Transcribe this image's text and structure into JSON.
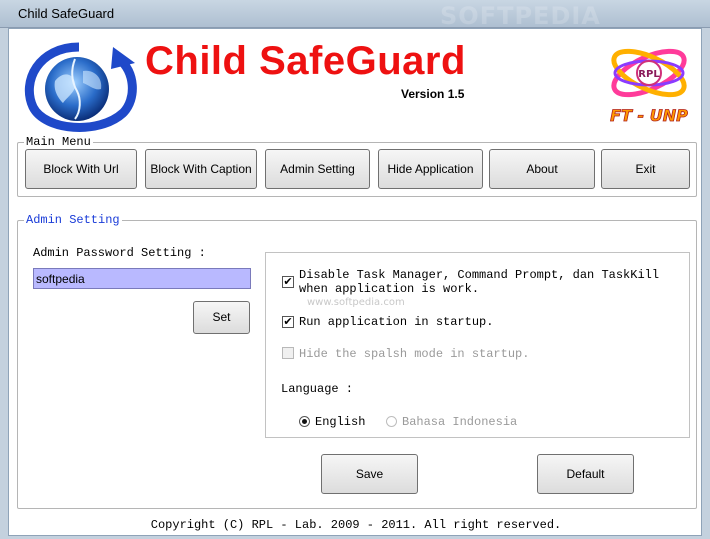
{
  "window": {
    "title": "Child SafeGuard",
    "watermark": "SOFTPEDIA"
  },
  "header": {
    "app_title": "Child SafeGuard",
    "version": "Version 1.5",
    "brand_right": "FT - UNP",
    "brand_right_badge": "RPL"
  },
  "main_menu": {
    "legend": "Main Menu",
    "buttons": [
      "Block With Url",
      "Block With Caption",
      "Admin Setting",
      "Hide Application",
      "About",
      "Exit"
    ]
  },
  "admin_setting": {
    "legend": "Admin Setting",
    "password_label": "Admin Password Setting :",
    "password_value": "softpedia",
    "set_label": "Set",
    "options": [
      {
        "label": "Disable Task Manager, Command Prompt, dan TaskKill when application is work.",
        "checked": true,
        "enabled": true
      },
      {
        "label": "Run application in startup.",
        "checked": true,
        "enabled": true
      },
      {
        "label": "Hide the spalsh mode in startup.",
        "checked": false,
        "enabled": false
      }
    ],
    "language_label": "Language :",
    "languages": [
      {
        "label": "English",
        "selected": true,
        "enabled": true
      },
      {
        "label": "Bahasa Indonesia",
        "selected": false,
        "enabled": false
      }
    ],
    "save_label": "Save",
    "default_label": "Default",
    "panel_watermark": "www.softpedia.com"
  },
  "footer": {
    "copyright": "Copyright (C) RPL - Lab. 2009 - 2011. All right reserved."
  },
  "colors": {
    "title_red": "#ee1111",
    "legend_blue": "#1a3cd8",
    "input_bg": "#b9b9ff"
  }
}
